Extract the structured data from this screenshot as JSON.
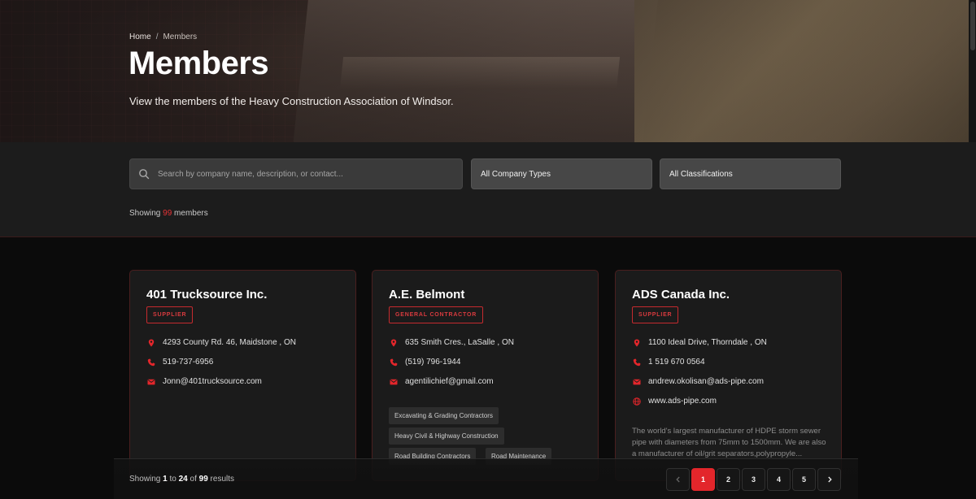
{
  "breadcrumb": {
    "home": "Home",
    "separator": "/",
    "current": "Members"
  },
  "hero": {
    "title": "Members",
    "subtitle": "View the members of the Heavy Construction Association of Windsor."
  },
  "filters": {
    "search_placeholder": "Search by company name, description, or contact...",
    "company_types": "All Company Types",
    "classifications": "All Classifications",
    "showing_prefix": "Showing",
    "showing_count": "99",
    "showing_suffix": "members"
  },
  "members": [
    {
      "name": "401 Trucksource Inc.",
      "type": "SUPPLIER",
      "address": "4293 County Rd. 46, Maidstone , ON",
      "phone": "519-737-6956",
      "email": "Jonn@401trucksource.com"
    },
    {
      "name": "A.E. Belmont",
      "type": "GENERAL CONTRACTOR",
      "address": "635 Smith Cres., LaSalle , ON",
      "phone": "(519) 796-1944",
      "email": "agentilichief@gmail.com",
      "tags": [
        "Excavating & Grading Contractors",
        "Heavy Civil & Highway Construction",
        "Road Building Contractors",
        "Road Maintenance"
      ]
    },
    {
      "name": "ADS Canada Inc.",
      "type": "SUPPLIER",
      "address": "1100 Ideal Drive, Thorndale , ON",
      "phone": "1 519 670 0564",
      "email": "andrew.okolisan@ads-pipe.com",
      "website": "www.ads-pipe.com",
      "description": "The world's largest manufacturer of HDPE storm sewer pipe with diameters from 75mm to 1500mm. We are also a manufacturer of oil/grit separators,polypropyle..."
    }
  ],
  "pagination": {
    "showing": "Showing",
    "from": "1",
    "to_word": "to",
    "to": "24",
    "of_word": "of",
    "total": "99",
    "results": "results",
    "pages": [
      "1",
      "2",
      "3",
      "4",
      "5"
    ],
    "current_page": "1"
  },
  "colors": {
    "accent": "#e3262b",
    "background": "#0b0b0b",
    "card": "#1b1b1b"
  },
  "icons": {
    "address": "map-pin-icon",
    "phone": "phone-icon",
    "email": "mail-icon",
    "website": "globe-icon",
    "search": "search-icon"
  }
}
